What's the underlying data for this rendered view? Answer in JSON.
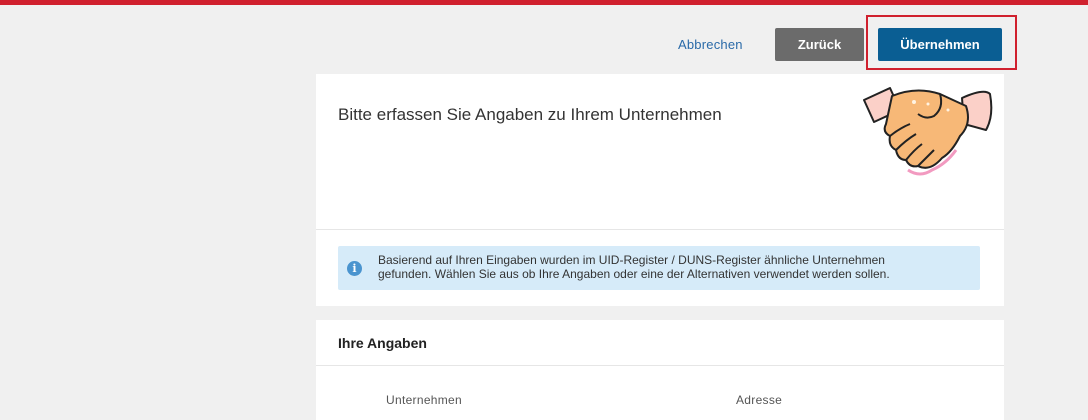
{
  "toolbar": {
    "cancel_label": "Abbrechen",
    "back_label": "Zurück",
    "apply_label": "Übernehmen"
  },
  "main_card": {
    "title": "Bitte erfassen Sie Angaben zu Ihrem Unternehmen",
    "info_icon": "info-icon",
    "info_text_line1": "Basierend auf Ihren Eingaben wurden im UID-Register / DUNS-Register ähnliche Unternehmen",
    "info_text_line2": "gefunden. Wählen Sie aus ob Ihre Angaben oder eine der Alternativen verwendet werden sollen.",
    "illustration": "handshake-icon"
  },
  "details_card": {
    "title": "Ihre Angaben",
    "columns": [
      "Unternehmen",
      "Adresse"
    ]
  },
  "colors": {
    "brand_red": "#d0202e",
    "primary_blue": "#0a5e93",
    "secondary_gray": "#6b6b6b",
    "info_bg": "#d6ebf9"
  }
}
